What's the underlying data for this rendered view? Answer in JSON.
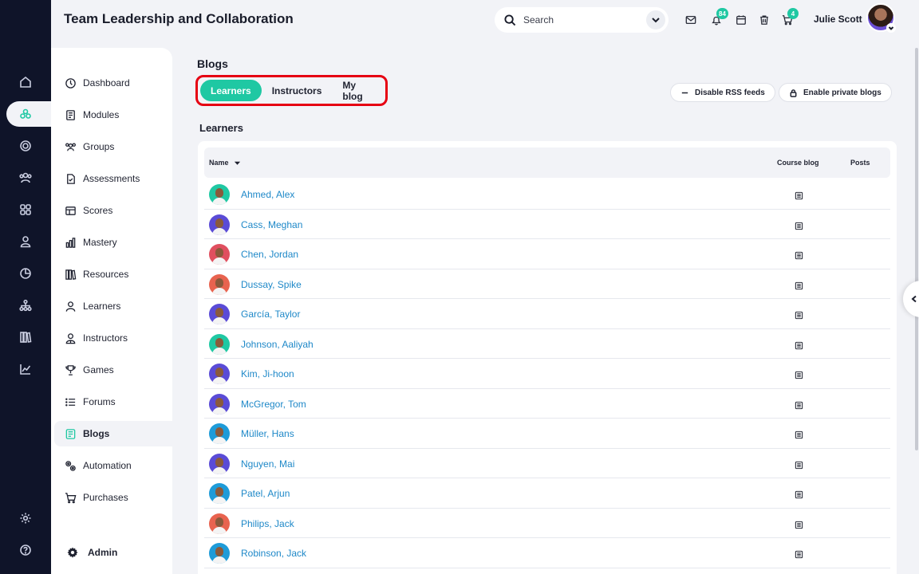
{
  "header": {
    "title": "Team Leadership and Collaboration",
    "search_placeholder": "Search",
    "notifications_badge": "84",
    "cart_badge": "4",
    "user_name": "Julie Scott"
  },
  "rail": {
    "icons": [
      "home-icon",
      "courses-icon",
      "target-icon",
      "users-icon",
      "apps-icon",
      "profile-icon",
      "reports-icon",
      "org-chart-icon",
      "library-icon",
      "analytics-icon",
      "settings-icon",
      "help-icon"
    ]
  },
  "sidebar": {
    "items": [
      {
        "label": "Dashboard",
        "icon": "dashboard-icon"
      },
      {
        "label": "Modules",
        "icon": "modules-icon"
      },
      {
        "label": "Groups",
        "icon": "groups-icon"
      },
      {
        "label": "Assessments",
        "icon": "assessments-icon"
      },
      {
        "label": "Scores",
        "icon": "scores-icon"
      },
      {
        "label": "Mastery",
        "icon": "mastery-icon"
      },
      {
        "label": "Resources",
        "icon": "resources-icon"
      },
      {
        "label": "Learners",
        "icon": "learners-icon"
      },
      {
        "label": "Instructors",
        "icon": "instructors-icon"
      },
      {
        "label": "Games",
        "icon": "games-icon"
      },
      {
        "label": "Forums",
        "icon": "forums-icon"
      },
      {
        "label": "Blogs",
        "icon": "blogs-icon",
        "active": true
      },
      {
        "label": "Automation",
        "icon": "automation-icon"
      },
      {
        "label": "Purchases",
        "icon": "purchases-icon"
      }
    ],
    "admin_label": "Admin"
  },
  "main": {
    "page_title": "Blogs",
    "tabs": [
      {
        "label": "Learners",
        "active": true
      },
      {
        "label": "Instructors"
      },
      {
        "label": "My blog"
      }
    ],
    "disable_rss_label": "Disable RSS feeds",
    "enable_private_label": "Enable private blogs",
    "section_title": "Learners",
    "table": {
      "columns": [
        "Name",
        "Course blog",
        "Posts"
      ],
      "rows": [
        {
          "name": "Ahmed, Alex",
          "avatar_bg": "#1fc8a3"
        },
        {
          "name": "Cass, Meghan",
          "avatar_bg": "#5a4bd6"
        },
        {
          "name": "Chen, Jordan",
          "avatar_bg": "#e04f5f"
        },
        {
          "name": "Dussay, Spike",
          "avatar_bg": "#e8634f"
        },
        {
          "name": "García, Taylor",
          "avatar_bg": "#5a4bd6"
        },
        {
          "name": "Johnson, Aaliyah",
          "avatar_bg": "#1fc8a3"
        },
        {
          "name": "Kim, Ji-hoon",
          "avatar_bg": "#5a4bd6"
        },
        {
          "name": "McGregor, Tom",
          "avatar_bg": "#5a4bd6"
        },
        {
          "name": "Müller, Hans",
          "avatar_bg": "#1e9bd8"
        },
        {
          "name": "Nguyen, Mai",
          "avatar_bg": "#5a4bd6"
        },
        {
          "name": "Patel, Arjun",
          "avatar_bg": "#1e9bd8"
        },
        {
          "name": "Philips, Jack",
          "avatar_bg": "#e8634f"
        },
        {
          "name": "Robinson, Jack",
          "avatar_bg": "#1e9bd8"
        }
      ]
    }
  },
  "colors": {
    "accent": "#1fc8a3",
    "link": "#1e88c8",
    "rail_bg": "#0f1429",
    "highlight_border": "#e60012"
  }
}
